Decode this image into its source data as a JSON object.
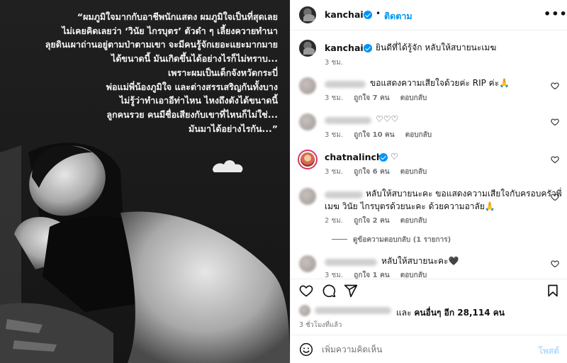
{
  "photo": {
    "quote_lines": [
      "“ผมภูมิใจมากกับอาชีพนักแสดง ผมภูมิใจเป็นที่สุดเลย",
      "ไม่เคยคิดเลยว่า ‘วินัย ไกรบุตร’ ตัวดำ ๆ เลี้ยงควายทำนา",
      "ลุยดินเผาถ่านอยู่ตามป่าตามเขา จะมีคนรู้จักเยอะแยะมากมาย",
      "ได้ขนาดนี้ มันเกิดขึ้นได้อย่างไรก็ไม่ทราบ...",
      "เพราะผมเป็นเด็กจังหวัดกระบี่",
      "พ่อแม่พี่น้องภูมิใจ และต่างสรรเสริญกันทั้งบาง",
      "ไม่รู้ว่าทำเอาอีท่าไหน ไหงถึงดังได้ขนาดนี้",
      "ลูกคนรวย คนมีชื่อเสียงกับเขาที่ไหนก็ไม่ใช่...",
      "มันมาได้อย่างไรกัน...”"
    ]
  },
  "header": {
    "username": "kanchai",
    "separator": "•",
    "follow_label": "ติดตาม",
    "more_label": "•••"
  },
  "caption": {
    "username": "kanchai",
    "text": "ยินดีที่ได้รู้จัก หลับให้สบายนะเมฆ",
    "time": "3 ชม."
  },
  "comments": [
    {
      "text": "ขอแสดงความเสียใจด้วยค่ะ RIP ค่ะ🙏",
      "time": "3 ชม.",
      "likes": "ถูกใจ 7 คน",
      "reply": "ตอบกลับ"
    },
    {
      "text": "♡♡♡",
      "time": "3 ชม.",
      "likes": "ถูกใจ 10 คน",
      "reply": "ตอบกลับ"
    },
    {
      "username": "chatnalinch",
      "text": "♡",
      "time": "3 ชม.",
      "likes": "ถูกใจ 6 คน",
      "reply": "ตอบกลับ"
    },
    {
      "text_line1": "หลับให้สบายนะคะ ขอแสดงความเสียใจกับครอบครัวพี่",
      "text_line2": "เมฆ วินัย ไกรบุตรด้วยนะคะ ด้วยความอาลัย🙏",
      "time": "2 ชม.",
      "likes": "ถูกใจ 2 คน",
      "reply": "ตอบกลับ",
      "view_replies": "ดูข้อความตอบกลับ (1 รายการ)"
    },
    {
      "text": "หลับให้สบายนะคะ🖤",
      "time": "3 ชม.",
      "likes": "ถูกใจ 1 คน",
      "reply": "ตอบกลับ"
    }
  ],
  "likes": {
    "prefix": "และ",
    "others": "คนอื่นๆ อีก 28,114 คน"
  },
  "posted_time": "3 ชั่วโมงที่แล้ว",
  "comment_box": {
    "placeholder": "เพิ่มความคิดเห็น",
    "post_label": "โพสต์"
  },
  "colors": {
    "link_blue": "#0095f6",
    "disabled_blue": "#b8dcfc",
    "secondary_text": "#737373",
    "divider": "#efefef"
  },
  "icons": [
    "heart-icon",
    "comment-icon",
    "share-icon",
    "bookmark-icon",
    "emoji-icon",
    "verified-badge-icon",
    "more-options-icon"
  ]
}
